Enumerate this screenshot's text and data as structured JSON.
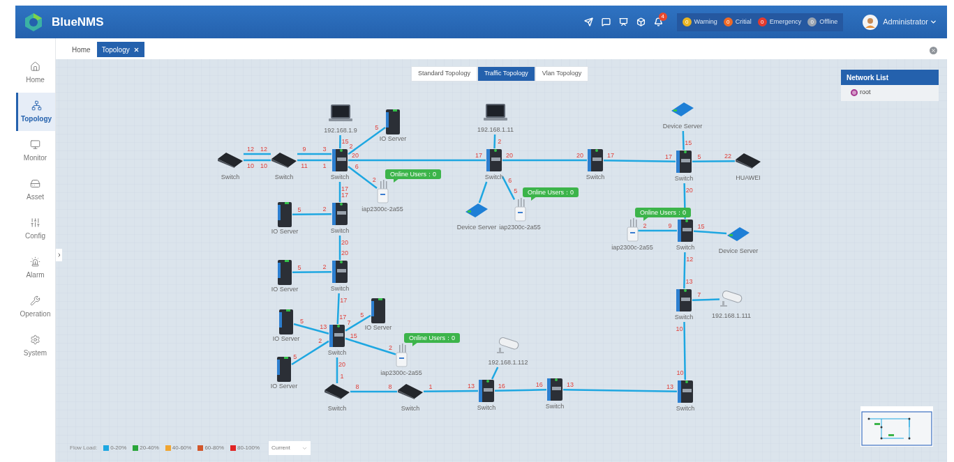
{
  "app": {
    "name": "BlueNMS"
  },
  "header": {
    "notification_badge": "4",
    "alarms": [
      {
        "count": "0",
        "label": "Warning",
        "color": "#e8b422"
      },
      {
        "count": "0",
        "label": "Critial",
        "color": "#ee6a26"
      },
      {
        "count": "0",
        "label": "Emergency",
        "color": "#e43b2e"
      },
      {
        "count": "0",
        "label": "Offline",
        "color": "#9aa4b1"
      }
    ],
    "user": "Administrator"
  },
  "sidebar": {
    "items": [
      {
        "label": "Home",
        "selected": false
      },
      {
        "label": "Topology",
        "selected": true
      },
      {
        "label": "Monitor",
        "selected": false
      },
      {
        "label": "Asset",
        "selected": false
      },
      {
        "label": "Config",
        "selected": false
      },
      {
        "label": "Alarm",
        "selected": false
      },
      {
        "label": "Operation",
        "selected": false
      },
      {
        "label": "System",
        "selected": false
      }
    ]
  },
  "tabs": [
    {
      "label": "Home",
      "selected": false,
      "closable": false
    },
    {
      "label": "Topology",
      "selected": true,
      "closable": true
    }
  ],
  "topology_modes": [
    {
      "label": "Standard Topology",
      "selected": false
    },
    {
      "label": "Traffic Topology",
      "selected": true
    },
    {
      "label": "Vlan Topology",
      "selected": false
    }
  ],
  "network_list": {
    "title": "Network List",
    "items": [
      {
        "label": "root"
      }
    ]
  },
  "legend": {
    "label": "Flow Load:",
    "items": [
      {
        "label": "0-20%",
        "color": "#1ea7e1"
      },
      {
        "label": "20-40%",
        "color": "#2aa53a"
      },
      {
        "label": "40-60%",
        "color": "#f0a531"
      },
      {
        "label": "60-80%",
        "color": "#d2562a"
      },
      {
        "label": "80-100%",
        "color": "#e02424"
      }
    ],
    "select": "Current"
  },
  "topology": {
    "nodes": [
      {
        "kind": "laptop",
        "label": "192.168.1.9"
      },
      {
        "kind": "io-server",
        "label": "IO Server"
      },
      {
        "kind": "laptop",
        "label": "192.168.1.11"
      },
      {
        "kind": "device-server",
        "label": "Device Server"
      },
      {
        "kind": "flat-switch",
        "label": "Switch"
      },
      {
        "kind": "flat-switch",
        "label": "Switch"
      },
      {
        "kind": "switch",
        "label": "Switch"
      },
      {
        "kind": "switch",
        "label": "Switch"
      },
      {
        "kind": "switch",
        "label": "Switch"
      },
      {
        "kind": "switch",
        "label": "Switch"
      },
      {
        "kind": "router",
        "label": "HUAWEI"
      },
      {
        "kind": "ap",
        "label": "iap2300c-2a55",
        "bubble": "Online Users：0"
      },
      {
        "kind": "io-server",
        "label": "IO Server"
      },
      {
        "kind": "switch",
        "label": "Switch"
      },
      {
        "kind": "device-server",
        "label": "Device Server"
      },
      {
        "kind": "ap",
        "label": "iap2300c-2a55",
        "bubble": "Online Users：0"
      },
      {
        "kind": "ap",
        "label": "iap2300c-2a55",
        "bubble": "Online Users：0"
      },
      {
        "kind": "switch",
        "label": "Switch"
      },
      {
        "kind": "device-server",
        "label": "Device Server"
      },
      {
        "kind": "io-server",
        "label": "IO Server"
      },
      {
        "kind": "switch",
        "label": "Switch"
      },
      {
        "kind": "io-server",
        "label": "IO Server"
      },
      {
        "kind": "io-server",
        "label": "IO Server"
      },
      {
        "kind": "switch",
        "label": "Switch"
      },
      {
        "kind": "camera",
        "label": "192.168.1.111"
      },
      {
        "kind": "switch",
        "label": "Switch"
      },
      {
        "kind": "io-server",
        "label": "IO Server"
      },
      {
        "kind": "ap",
        "label": "iap2300c-2a55",
        "bubble": "Online Users：0"
      },
      {
        "kind": "camera",
        "label": "192.168.1.112"
      },
      {
        "kind": "flat-switch",
        "label": "Switch"
      },
      {
        "kind": "flat-switch",
        "label": "Switch"
      },
      {
        "kind": "switch",
        "label": "Switch"
      },
      {
        "kind": "switch",
        "label": "Switch"
      },
      {
        "kind": "switch",
        "label": "Switch"
      }
    ],
    "links": [
      {
        "b": "15"
      },
      {
        "a": "2",
        "b": "5"
      },
      {
        "b": "2"
      },
      {
        "b": "15"
      },
      {
        "a": "12",
        "b": "12"
      },
      {
        "a": "10",
        "b": "10"
      },
      {
        "a": "9",
        "b": "3"
      },
      {
        "a": "11",
        "b": "1"
      },
      {
        "a": "20",
        "b": "17"
      },
      {
        "a": "20",
        "b": "20"
      },
      {
        "a": "17",
        "b": "17"
      },
      {
        "a": "5",
        "b": "22"
      },
      {
        "a": "6",
        "b": "2"
      },
      {
        "a": "17",
        "b": "17"
      },
      {
        "a": "6",
        "b": "5"
      },
      {
        "a": "20"
      },
      {
        "a": "5",
        "b": "2"
      },
      {
        "a": "2",
        "b": "9"
      },
      {
        "a": "15"
      },
      {
        "a": "20",
        "b": "20"
      },
      {
        "a": "12",
        "b": "13"
      },
      {
        "a": "5",
        "b": "2"
      },
      {
        "a": "17",
        "b": "17"
      },
      {
        "a": "7"
      },
      {
        "a": "10",
        "b": "10"
      },
      {
        "a": "5",
        "b": "13"
      },
      {
        "a": "5",
        "b": "2"
      },
      {
        "a": "7",
        "b": "5"
      },
      {
        "a": "15",
        "b": "2"
      },
      {
        "a": "20",
        "b": "1"
      },
      {
        "a": "8",
        "b": "8"
      },
      {
        "a": "1",
        "b": "13"
      },
      {
        "a": "16",
        "b": "16"
      },
      {
        "a": "13",
        "b": "13"
      }
    ]
  }
}
